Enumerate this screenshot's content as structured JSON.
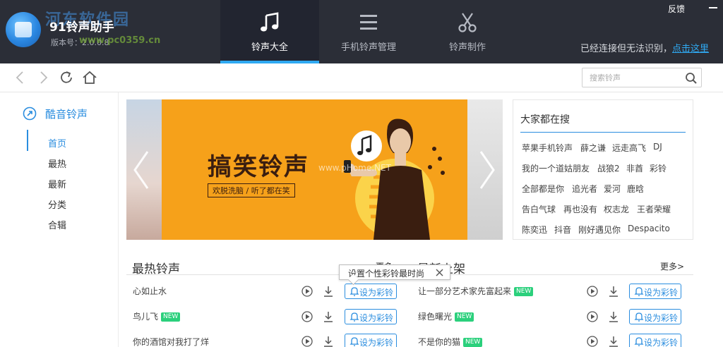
{
  "header": {
    "app_title": "91铃声助手",
    "version": "版本号：2.0.0.8",
    "watermark_cn": "河东软件园",
    "watermark_url": "www.pc0359.cn",
    "tabs": [
      {
        "label": "铃声大全",
        "icon": "music-note-icon",
        "active": true
      },
      {
        "label": "手机铃声管理",
        "icon": "list-icon",
        "active": false
      },
      {
        "label": "铃声制作",
        "icon": "scissors-icon",
        "active": false
      }
    ],
    "feedback_label": "反馈",
    "connection_text": "已经连接但无法识别，",
    "connection_link": "点击这里"
  },
  "toolbar": {
    "search_placeholder": "搜索铃声"
  },
  "sidebar": {
    "heading": "酷音铃声",
    "items": [
      {
        "label": "首页",
        "active": true
      },
      {
        "label": "最热",
        "active": false
      },
      {
        "label": "最新",
        "active": false
      },
      {
        "label": "分类",
        "active": false
      },
      {
        "label": "合辑",
        "active": false
      }
    ]
  },
  "banner": {
    "title": "搞笑铃声",
    "subtitle": "欢脱洗脑 / 听了都在笑",
    "watermark": "www.pHome.NET"
  },
  "hot_search": {
    "title": "大家都在搜",
    "rows": [
      [
        "苹果手机铃声",
        "薛之谦",
        "远走高飞",
        "DJ"
      ],
      [
        "我的一个道姑朋友",
        "战狼2",
        "非酋",
        "彩铃"
      ],
      [
        "全部都是你",
        "追光者",
        "爱河",
        "鹿晗"
      ],
      [
        "告白气球",
        "再也没有",
        "权志龙",
        "王者荣耀"
      ],
      [
        "陈奕迅",
        "抖音",
        "刚好遇见你",
        "Despacito"
      ]
    ]
  },
  "hot_songs": {
    "title": "最热铃声",
    "more": "更多>",
    "items": [
      {
        "name": "心如止水",
        "badge": ""
      },
      {
        "name": "鸟儿飞",
        "badge": "NEW"
      },
      {
        "name": "你的酒馆对我打了烊",
        "badge": ""
      }
    ]
  },
  "new_songs": {
    "title": "最新上架",
    "more": "更多>",
    "items": [
      {
        "name": "让一部分艺术家先富起来",
        "badge": "NEW"
      },
      {
        "name": "绿色曙光",
        "badge": "NEW"
      },
      {
        "name": "不是你的猫",
        "badge": "NEW"
      }
    ]
  },
  "set_ringtone_label": "设为彩铃",
  "tooltip_text": "设置个性彩铃最时尚",
  "colors": {
    "accent": "#2a8ddf",
    "topbar": "#2b2e37",
    "tab_underline": "#2fa9f2",
    "badge": "#2bd07c",
    "banner": "#f6a11a"
  }
}
